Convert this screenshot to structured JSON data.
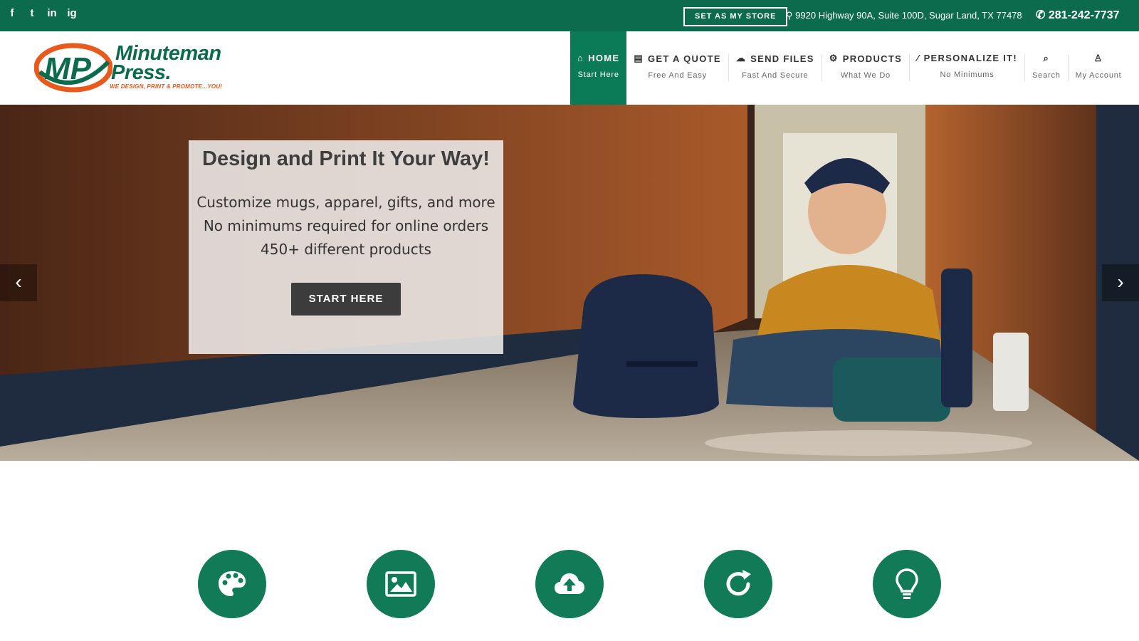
{
  "topbar": {
    "social": [
      {
        "name": "facebook-icon",
        "glyph": "f"
      },
      {
        "name": "twitter-icon",
        "glyph": "t"
      },
      {
        "name": "linkedin-icon",
        "glyph": "in"
      },
      {
        "name": "instagram-icon",
        "glyph": "ig"
      }
    ],
    "store_button": "SET AS MY STORE",
    "address": "9920 Highway 90A, Suite 100D, Sugar Land, TX 77478",
    "phone": "281-242-7737"
  },
  "logo": {
    "line1": "Minuteman",
    "line2": "Press.",
    "tagline": "WE DESIGN, PRINT & PROMOTE...YOU!"
  },
  "nav": [
    {
      "title": "HOME",
      "sub": "Start Here",
      "icon": "home-icon",
      "active": true
    },
    {
      "title": "GET A QUOTE",
      "sub": "Free And Easy",
      "icon": "document-icon"
    },
    {
      "title": "SEND FILES",
      "sub": "Fast And Secure",
      "icon": "cloud-upload-icon"
    },
    {
      "title": "PRODUCTS",
      "sub": "What We Do",
      "icon": "gears-icon"
    },
    {
      "title": "PERSONALIZE IT!",
      "sub": "No Minimums",
      "icon": "magic-wand-icon"
    },
    {
      "title": "",
      "sub": "Search",
      "icon": "search-icon"
    },
    {
      "title": "",
      "sub": "My Account",
      "icon": "user-icon"
    }
  ],
  "hero": {
    "title": "Design and Print It Your Way!",
    "lines": [
      "Customize mugs, apparel, gifts, and more",
      "No minimums required for online orders",
      "450+ different products"
    ],
    "button": "START HERE",
    "prev_icon": "chevron-left-icon",
    "next_icon": "chevron-right-icon"
  },
  "features": [
    {
      "icon": "palette-icon"
    },
    {
      "icon": "image-icon"
    },
    {
      "icon": "cloud-upload-icon"
    },
    {
      "icon": "refresh-icon"
    },
    {
      "icon": "lightbulb-icon"
    }
  ],
  "colors": {
    "brand_green": "#0b6b4c",
    "nav_active": "#0b7a56",
    "accent_orange": "#e85a1b",
    "button_dark": "#3c3c3c"
  }
}
